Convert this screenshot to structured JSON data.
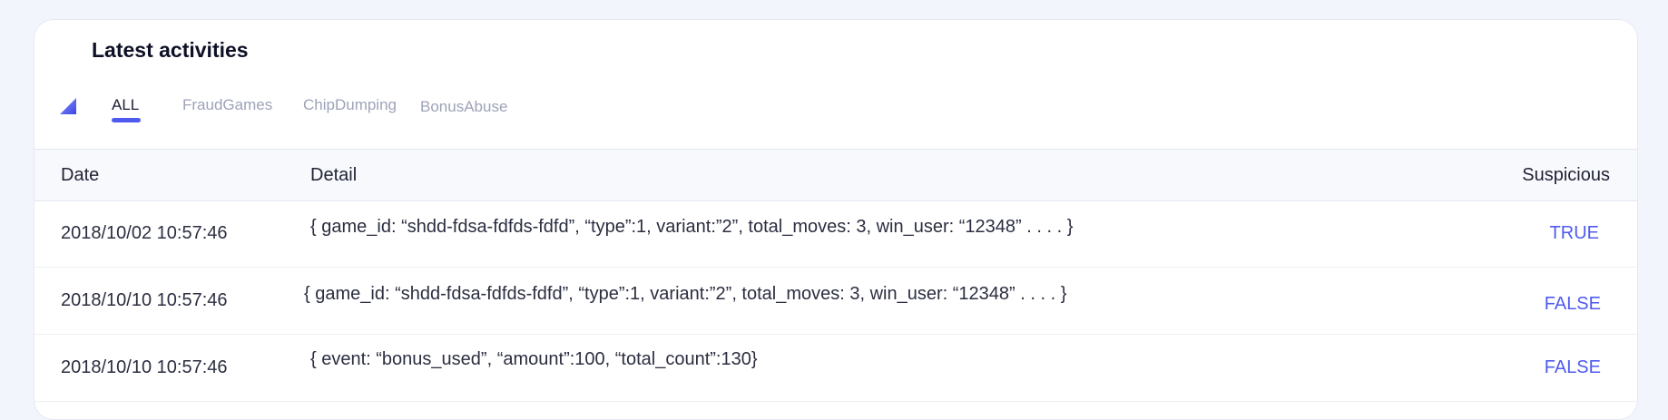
{
  "panel": {
    "title": "Latest activities"
  },
  "tabs": [
    {
      "label": "ALL",
      "active": true
    },
    {
      "label": "FraudGames",
      "active": false
    },
    {
      "label": "ChipDumping",
      "active": false
    },
    {
      "label": "BonusAbuse",
      "active": false
    }
  ],
  "table": {
    "columns": {
      "date": "Date",
      "detail": "Detail",
      "suspicious": "Suspicious"
    },
    "rows": [
      {
        "date": "2018/10/02 10:57:46",
        "detail": "{ game_id: “shdd-fdsa-fdfds-fdfd”, “type”:1, variant:”2”, total_moves: 3, win_user: “12348” . . . . }",
        "suspicious": "TRUE"
      },
      {
        "date": "2018/10/10 10:57:46",
        "detail": "{ game_id: “shdd-fdsa-fdfds-fdfd”, “type”:1, variant:”2”, total_moves: 3, win_user: “12348” . . . . }",
        "suspicious": "FALSE"
      },
      {
        "date": "2018/10/10 10:57:46",
        "detail": "{ event: “bonus_used”, “amount”:100, “total_count”:130}",
        "suspicious": "FALSE"
      }
    ]
  },
  "colors": {
    "accent": "#4f5bef",
    "background": "#f3f5fd",
    "card": "#ffffff",
    "header_row": "#f8f9fd"
  },
  "icons": {
    "filter": "filter-triangle-icon"
  }
}
